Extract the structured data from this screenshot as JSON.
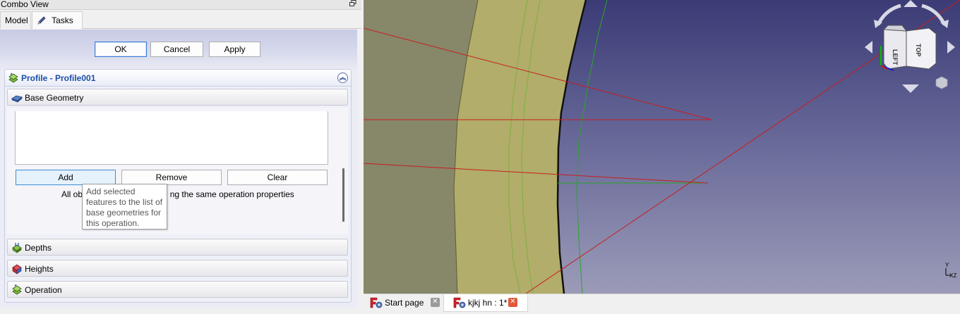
{
  "combo_view": {
    "title": "Combo View",
    "undock_icon": "undock-icon"
  },
  "tabs": [
    {
      "label": "Model",
      "active": false
    },
    {
      "label": "Tasks",
      "active": true,
      "icon": "pencil-icon"
    }
  ],
  "dialog_buttons": {
    "ok": "OK",
    "cancel": "Cancel",
    "apply": "Apply"
  },
  "profile": {
    "title": "Profile - Profile001",
    "icon": "profile-operation-icon",
    "collapse_icon": "collapse-up-icon"
  },
  "base_geometry": {
    "title": "Base Geometry",
    "icon": "base-geometry-icon",
    "buttons": {
      "add": "Add",
      "remove": "Remove",
      "clear": "Clear"
    },
    "note_left": "All obj",
    "note_right": "ng the same operation properties"
  },
  "tooltip": {
    "text": "Add selected features to the list of base geometries for this operation."
  },
  "sections": {
    "depths": "Depths",
    "heights": "Heights",
    "operation": "Operation"
  },
  "navcube": {
    "left_face": "LEFT",
    "top_face": "TOP"
  },
  "axis_indicator": {
    "y": "Y",
    "xz": "XZ"
  },
  "doc_tabs": [
    {
      "label": "Start page",
      "active": false
    },
    {
      "label": "kjkj hn : 1*",
      "active": true
    }
  ],
  "colors": {
    "header_text": "#1d4fa8",
    "default_button_border": "#3b7bd6",
    "view_bg_top": "#3b3b76",
    "view_bg_bottom": "#9b9bb8",
    "part_fill": "#b2ad6a",
    "sketch_line": "#c81e1e",
    "path_line": "#2aa52a",
    "close_active": "#e05a3a"
  }
}
